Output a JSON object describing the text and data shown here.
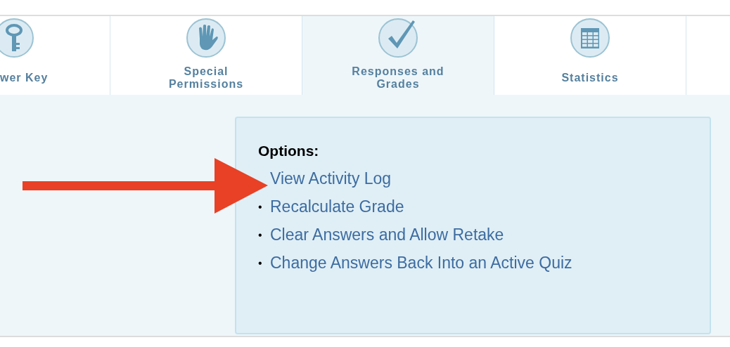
{
  "tabs": [
    {
      "label": "wer Key",
      "kind": "key",
      "selected": false
    },
    {
      "label": "Special Permissions",
      "kind": "hand",
      "selected": false
    },
    {
      "label": "Responses and Grades",
      "kind": "check",
      "selected": true
    },
    {
      "label": "Statistics",
      "kind": "table",
      "selected": false
    }
  ],
  "options": {
    "heading": "Options:",
    "items": [
      {
        "label": "View Activity Log"
      },
      {
        "label": "Recalculate Grade",
        "bullet": "•"
      },
      {
        "label": "Clear Answers and Allow Retake",
        "bullet": "•"
      },
      {
        "label": "Change Answers Back Into an Active Quiz",
        "bullet": "•"
      }
    ]
  }
}
